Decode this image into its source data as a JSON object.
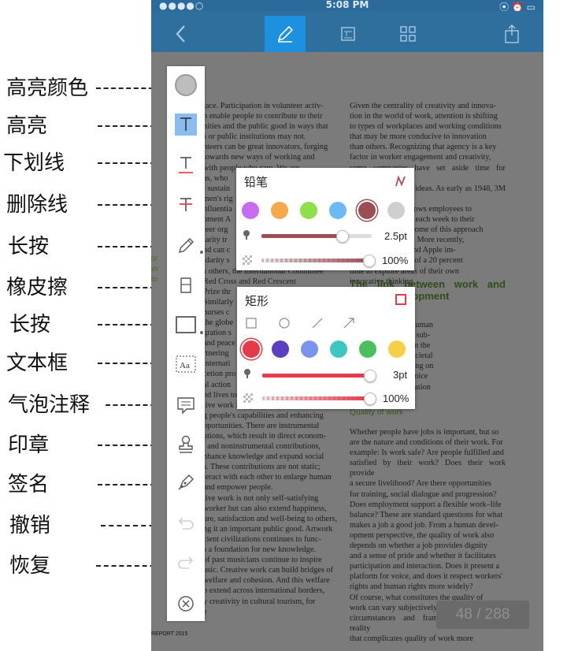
{
  "annotations": [
    {
      "label": "高亮颜色"
    },
    {
      "label": "高亮"
    },
    {
      "label": "下划线"
    },
    {
      "label": "删除线"
    },
    {
      "label": "长按"
    },
    {
      "label": "橡皮擦"
    },
    {
      "label": "长按"
    },
    {
      "label": "文本框"
    },
    {
      "label": "气泡注释"
    },
    {
      "label": "印章"
    },
    {
      "label": "签名"
    },
    {
      "label": "撤销"
    },
    {
      "label": "恢复"
    }
  ],
  "status_bar": {
    "time": "5:08 PM",
    "signal": "●●●●○",
    "right": "⦿ ⏰ ▭"
  },
  "nav": {
    "back_icon": "chevron-left-icon",
    "active_tool_icon": "pencil-icon",
    "outline_icon": "outline-icon",
    "grid_icon": "grid-icon",
    "share_icon": "share-icon",
    "active_color": "#1e90e0",
    "bar_color": "#2f6f9e"
  },
  "pencil_popup": {
    "title": "铅笔",
    "colors": [
      "#c66cf0",
      "#f5a94a",
      "#8ee04a",
      "#6bb9f5",
      "#9b4f55",
      "#cfcfcf"
    ],
    "selected_color": "#9b4f55",
    "thickness_value": "2.5pt",
    "thickness_fraction": 0.73,
    "opacity_value": "100%",
    "opacity_fraction": 1.0
  },
  "rect_popup": {
    "title": "矩形",
    "shapes": [
      "rectangle-shape-icon",
      "circle-shape-icon",
      "line-shape-icon",
      "arrow-shape-icon"
    ],
    "colors": [
      "#e53a4a",
      "#5c3fc0",
      "#7b93f0",
      "#3cc7c0",
      "#4cbe5e",
      "#f7cf45"
    ],
    "selected_color": "#e53a4a",
    "thickness_value": "3pt",
    "thickness_fraction": 1.0,
    "opacity_value": "100%",
    "opacity_fraction": 1.0
  },
  "document": {
    "left_col": "lace. Participation in volunteer activ-\nn enable people to contribute to their\nnities and the public good in ways that\ns or public institutions may not.\nnteers can be great innovators, forging\n towards new ways of working and\nwith people who care. We are\nas, who\nt sustain\nmen's rig\nnfluentia\npment A\nteer org\nlarity tr\nnd can c\nidarity s\ns others, the International Committee\nRed Cross and Red Crescent\nPrize thr\nSimilarly\nnurses c\nthe globe\ngration s\nand peace\nrtnering\ninternati\ncetion pro\nal action\nnd lives to others.\ntive work is equally important for ex-\ng people's capabilities and enhancing\npportunities. There are instrumental\nutions, which result in direct econom-\n, and noninstrumental contributions,\nnhance knowledge and expand social\ns. These contributions are not static;\nteract with each other to enlarge human\nand empower people.\ntive work is not only self-satisfying\nworker but can also extend happiness,\nure, satisfaction and well-being to others,\nng it an important public good. Artwork\ncient civilizations continues to func-\ns a foundation for new knowledge.\nof past musicians continue to inspire\nusic. Creative work can build bridges of\nwelfare and cohesion. And this welfare\no extend across international borders,\ny creativity in cultural tourism, for\ne",
    "right_col_top": "Given the centrality of creativity and innova-\ntion in the world of work, attention is shifting\nto types of workplaces and working conditions\nthat may be more conducive to innovation\nthan others. Recognizing that agency is a key\nfactor in worker engagement and creativity,\nsome companies have set aside time for workers\nto pursue their own ideas. As early as 1948, 3M has\nhad a policy that allows employees to\nspend 15 percent of each week to their\nown ideas. The outcome of this approach\nhas been the Post-it. More recently,\nGoogle, LinkedIn and Apple im-\nplemented versions of a 20 percent\ntime to explore areas of their own\ninnovative thinking.",
    "heading": "The link between work and human development",
    "right_col_mid": "between work and human\nautomatic. They are sub-\nditions, ranging from the\nindividuals to the societal\nnk can vary depending on\nnities for workers' voice\nd whether discrimination\nommon at work.",
    "quality_heading": "Quality of work",
    "right_col_bottom": "Whether people have jobs is important, but so\nare the nature and conditions of their work. For\nexample: Is work safe? Are people fulfilled and\nsatisfied by their work? Does their work provide\na secure livelihood? Are there opportunities\nfor training, social dialogue and progression?\nDoes employment support a flexible work–life\nbalance? These are standard questions for what\nmakes a job a good job. From a human devel-\nopment perspective, the quality of work also\ndepends on whether a job provides dignity\nand a sense of pride and whether it facilitates\nparticipation and interaction. Does it present a\nplatform for voice, and does it respect workers'\nrights and human rights more widely?\n    Of course, what constitutes the quality of\nwork can vary subjectively by country, personal\ncircumstances and frame of reference—a reality\nthat complicates quality of work more",
    "footer": "REPORT 2015",
    "page_indicator": "48 / 288"
  },
  "toolbar": [
    {
      "name": "highlight-color-button",
      "icon": "circle-color-icon"
    },
    {
      "name": "highlight-button",
      "icon": "highlight-t-icon"
    },
    {
      "name": "underline-button",
      "icon": "underline-t-icon"
    },
    {
      "name": "strikethrough-button",
      "icon": "strikethrough-t-icon"
    },
    {
      "name": "pencil-button",
      "icon": "pencil-icon"
    },
    {
      "name": "eraser-button",
      "icon": "eraser-icon"
    },
    {
      "name": "rectangle-button",
      "icon": "rectangle-icon"
    },
    {
      "name": "textbox-button",
      "icon": "textbox-icon"
    },
    {
      "name": "comment-bubble-button",
      "icon": "speech-bubble-icon"
    },
    {
      "name": "stamp-button",
      "icon": "stamp-icon"
    },
    {
      "name": "signature-button",
      "icon": "signature-pen-icon"
    },
    {
      "name": "undo-button",
      "icon": "undo-icon"
    },
    {
      "name": "redo-button",
      "icon": "redo-icon"
    },
    {
      "name": "close-toolbar-button",
      "icon": "close-circle-icon"
    }
  ]
}
